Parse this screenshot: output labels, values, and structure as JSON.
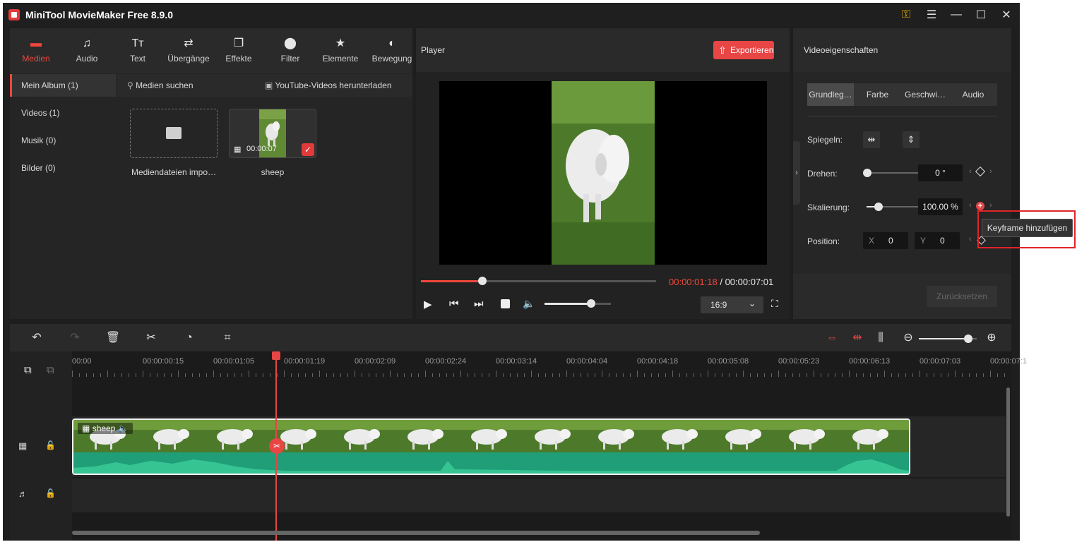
{
  "app": {
    "title": "MiniTool MovieMaker Free 8.9.0",
    "accent": "#f0473c"
  },
  "toolbar": {
    "items": [
      {
        "label": "Medien",
        "icon": "folder-icon",
        "active": true
      },
      {
        "label": "Audio",
        "icon": "music-note-icon"
      },
      {
        "label": "Text",
        "icon": "text-icon"
      },
      {
        "label": "Übergänge",
        "icon": "transition-icon"
      },
      {
        "label": "Effekte",
        "icon": "effects-icon"
      },
      {
        "label": "Filter",
        "icon": "filter-icon"
      },
      {
        "label": "Elemente",
        "icon": "elements-icon"
      },
      {
        "label": "Bewegung",
        "icon": "motion-icon"
      }
    ]
  },
  "album": {
    "items": [
      {
        "label": "Mein Album (1)",
        "active": true
      },
      {
        "label": "Videos (1)"
      },
      {
        "label": "Musik (0)"
      },
      {
        "label": "Bilder (0)"
      }
    ]
  },
  "media": {
    "search_label": "Medien suchen",
    "youtube_label": "YouTube-Videos herunterladen",
    "import_label": "Mediendateien impo…",
    "clip_name": "sheep",
    "clip_duration": "00:00:07"
  },
  "player": {
    "title": "Player",
    "export_label": "Exportieren",
    "current_time": "00:00:01:18",
    "separator": "/",
    "total_time": "00:00:07:01",
    "progress": 0.26,
    "volume": 0.7,
    "aspect": "16:9"
  },
  "properties": {
    "title": "Videoeigenschaften",
    "tabs": [
      "Grundleg…",
      "Farbe",
      "Geschwi…",
      "Audio"
    ],
    "mirror_label": "Spiegeln:",
    "rotate_label": "Drehen:",
    "rotate_value": "0 °",
    "scale_label": "Skalierung:",
    "scale_value": "100.00 %",
    "position_label": "Position:",
    "x_label": "X",
    "x_value": "0",
    "y_label": "Y",
    "y_value": "0",
    "reset_label": "Zurücksetzen",
    "tooltip": "Keyframe hinzufügen"
  },
  "timeline": {
    "ruler": [
      "00:00",
      "00:00:00:15",
      "00:00:01:05",
      "00:00:01:19",
      "00:00:02:09",
      "00:00:02:24",
      "00:00:03:14",
      "00:00:04:04",
      "00:00:04:18",
      "00:00:05:08",
      "00:00:05:23",
      "00:00:06:13",
      "00:00:07:03",
      "00:00:07:1"
    ],
    "clip_label": "sheep",
    "zoom": 0.85
  }
}
